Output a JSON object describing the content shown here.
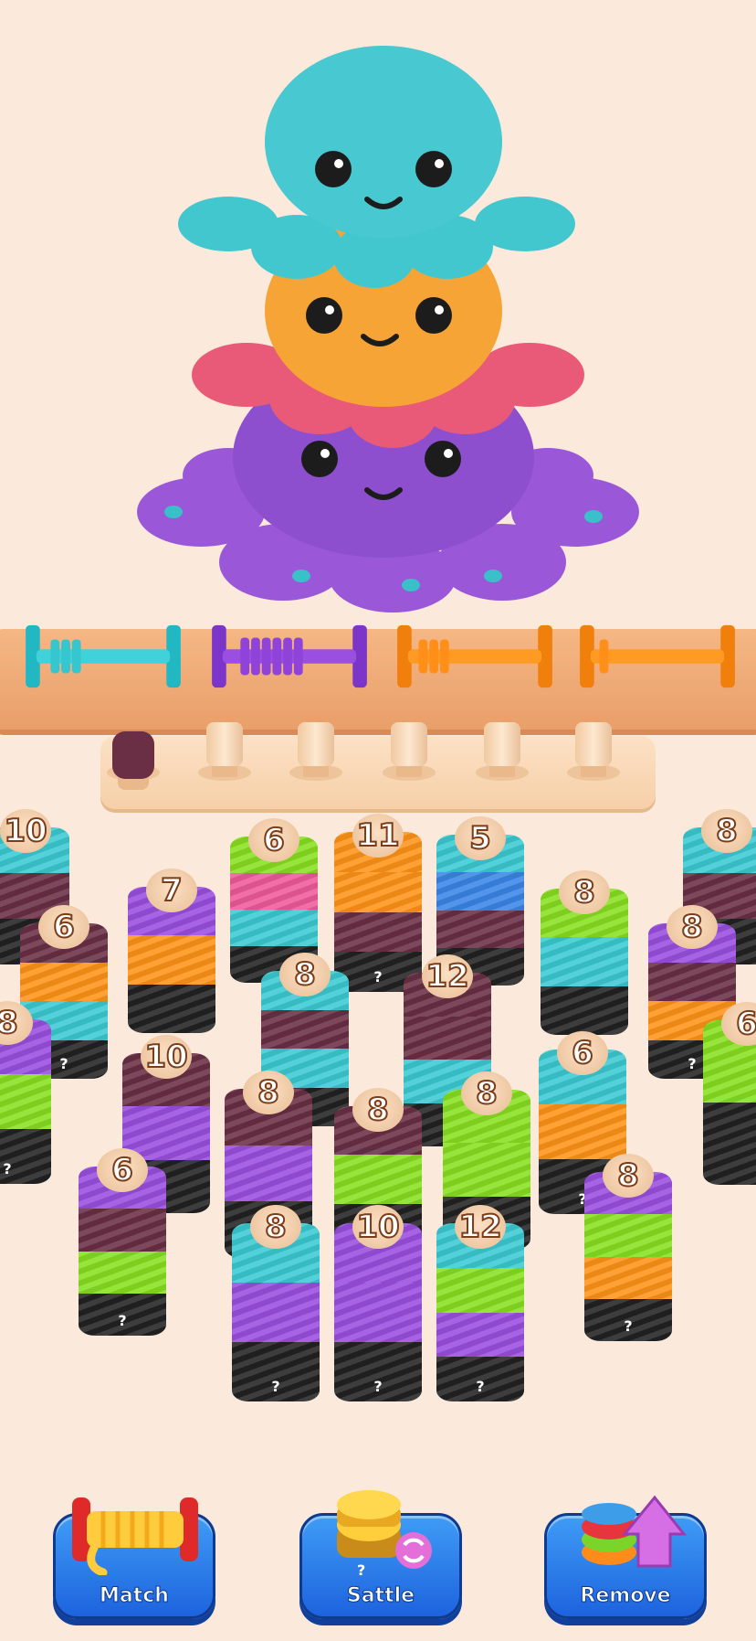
{
  "colors": {
    "background": "#fbeadb",
    "teal": "#3ccbd3",
    "purple": "#9a4fe0",
    "orange": "#ff9418",
    "lime": "#88e021",
    "plum": "#6a2f44",
    "blue": "#3a86e8",
    "pink": "#f05a9a",
    "black": "#222222",
    "button_blue": "#2b7ef0"
  },
  "character": {
    "icon": "knitted-octopus-stack-illustration"
  },
  "spools": [
    {
      "color": "teal",
      "icon": "spool-icon"
    },
    {
      "color": "purple",
      "icon": "spool-icon"
    },
    {
      "color": "orange",
      "icon": "spool-icon"
    },
    {
      "color": "orange",
      "icon": "spool-icon"
    }
  ],
  "pegs": [
    {
      "filled": true,
      "color": "plum"
    },
    {
      "filled": false
    },
    {
      "filled": false
    },
    {
      "filled": false
    },
    {
      "filled": false
    },
    {
      "filled": false
    }
  ],
  "stacks": [
    {
      "count": "10",
      "bands": [
        "teal",
        "plum",
        "black"
      ],
      "hidden": false
    },
    {
      "count": "6",
      "bands": [
        "lime",
        "pink",
        "teal",
        "black"
      ],
      "hidden": false
    },
    {
      "count": "11",
      "bands": [
        "orange",
        "orange",
        "plum",
        "black"
      ],
      "hidden": true,
      "hidden_label": "?"
    },
    {
      "count": "5",
      "bands": [
        "teal",
        "blue",
        "plum",
        "black"
      ],
      "hidden": false
    },
    {
      "count": "8",
      "bands": [
        "teal",
        "plum",
        "black"
      ],
      "hidden": false
    },
    {
      "count": "7",
      "bands": [
        "purple",
        "orange",
        "black"
      ],
      "hidden": false
    },
    {
      "count": "8",
      "bands": [
        "lime",
        "teal",
        "black"
      ],
      "hidden": false
    },
    {
      "count": "6",
      "bands": [
        "plum",
        "orange",
        "teal",
        "black"
      ],
      "hidden": true,
      "hidden_label": "?"
    },
    {
      "count": "8",
      "bands": [
        "purple",
        "plum",
        "orange",
        "black"
      ],
      "hidden": true,
      "hidden_label": "?"
    },
    {
      "count": "8",
      "bands": [
        "teal",
        "plum",
        "teal",
        "black"
      ],
      "hidden": false
    },
    {
      "count": "12",
      "bands": [
        "plum",
        "plum",
        "teal",
        "black"
      ],
      "hidden": false
    },
    {
      "count": "8",
      "bands": [
        "purple",
        "lime",
        "black"
      ],
      "hidden": true,
      "hidden_label": "?"
    },
    {
      "count": "10",
      "bands": [
        "plum",
        "purple",
        "black"
      ],
      "hidden": false
    },
    {
      "count": "6",
      "bands": [
        "teal",
        "orange",
        "black"
      ],
      "hidden": true,
      "hidden_label": "?"
    },
    {
      "count": "6",
      "bands": [
        "lime",
        "black"
      ],
      "hidden": false
    },
    {
      "count": "8",
      "bands": [
        "plum",
        "purple",
        "black"
      ],
      "hidden": false
    },
    {
      "count": "8",
      "bands": [
        "plum",
        "lime",
        "black"
      ],
      "hidden": false
    },
    {
      "count": "8",
      "bands": [
        "lime",
        "lime",
        "black"
      ],
      "hidden": false
    },
    {
      "count": "6",
      "bands": [
        "purple",
        "plum",
        "lime",
        "black"
      ],
      "hidden": true,
      "hidden_label": "?"
    },
    {
      "count": "8",
      "bands": [
        "purple",
        "lime",
        "orange",
        "black"
      ],
      "hidden": true,
      "hidden_label": "?"
    },
    {
      "count": "8",
      "bands": [
        "teal",
        "purple",
        "black"
      ],
      "hidden": true,
      "hidden_label": "?"
    },
    {
      "count": "10",
      "bands": [
        "purple",
        "purple",
        "black"
      ],
      "hidden": true,
      "hidden_label": "?"
    },
    {
      "count": "12",
      "bands": [
        "teal",
        "lime",
        "purple",
        "black"
      ],
      "hidden": true,
      "hidden_label": "?"
    }
  ],
  "toolbar": {
    "match_label": "Match",
    "match_icon": "yarn-spool-icon",
    "sattle_label": "Sattle",
    "sattle_icon": "shuffle-coins-icon",
    "sattle_hidden_label": "?",
    "remove_label": "Remove",
    "remove_icon": "arrow-up-yarn-icon"
  }
}
